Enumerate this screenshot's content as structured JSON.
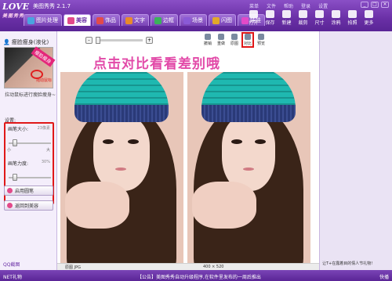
{
  "app": {
    "title": "美图秀秀 2.1.7",
    "logo": "LOVE",
    "logo_sub": "美图秀秀",
    "menu": [
      "菜单",
      "文件",
      "帮助",
      "登录",
      "设置"
    ],
    "window_buttons": [
      "_",
      "□",
      "×"
    ]
  },
  "tabs": [
    {
      "label": "图片处理",
      "color": "#4aa3df"
    },
    {
      "label": "美容",
      "color": "#e24a8a"
    },
    {
      "label": "饰品",
      "color": "#e24a4a"
    },
    {
      "label": "文字",
      "color": "#e88a2a"
    },
    {
      "label": "边框",
      "color": "#3ab35a"
    },
    {
      "label": "场景",
      "color": "#8a5ad6"
    },
    {
      "label": "闪图",
      "color": "#e2a82a"
    },
    {
      "label": "娃娃",
      "color": "#e24ac8"
    }
  ],
  "active_tab_index": 1,
  "top_tools": [
    "打开",
    "保存",
    "新建",
    "裁剪",
    "尺寸",
    "涂鸦",
    "拍照",
    "更多"
  ],
  "left_panel": {
    "title": "瘦脸瘦身(液化)",
    "thumb_tag": "瘦脸瘦身",
    "thumb_red_text": "拖动鼠标",
    "hint": "拉动鼠标进行瘦脸瘦身~",
    "settings_label": "设置:",
    "slider1": {
      "label": "画笔大小:",
      "value": "23像素",
      "min": "小",
      "max": "大",
      "fraction": 0.1
    },
    "slider2": {
      "label": "画笔力度:",
      "value": "30%",
      "min": "小",
      "max": "大",
      "fraction": 0.1
    },
    "btn_enable": "启用圆笔",
    "btn_back": "返回到美容",
    "qq": "QQ截图"
  },
  "center": {
    "zoom_minus": "-",
    "zoom_plus": "+",
    "actions": [
      "撤销",
      "重做",
      "原图",
      "对比",
      "预览"
    ],
    "highlighted_action": "对比",
    "banner": "点击对比看看差别哦",
    "bottom_label": "原图 JPG",
    "dimensions": "400 × 520"
  },
  "right_panel": {
    "ad": "让T+在露着目的情人节礼物!"
  },
  "status": {
    "left": "NET礼物",
    "middle": "【公告】美图秀秀自动升级程序,在软件里发布的一周后推出",
    "right": "快播"
  }
}
